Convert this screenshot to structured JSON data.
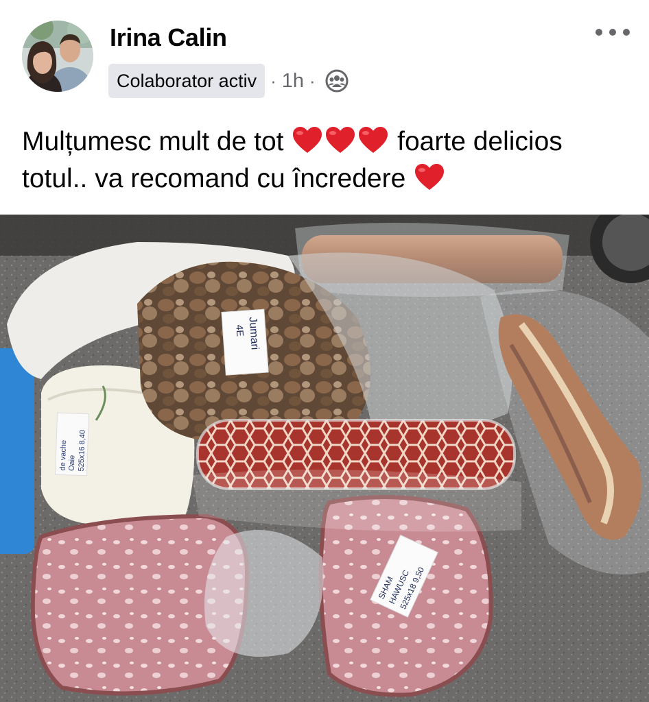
{
  "post": {
    "author": "Irina Calin",
    "badge": "Colaborator activ",
    "time": "1h",
    "separator": "·",
    "audience_icon": "group-audience-icon",
    "more_icon": "more-options-icon",
    "text_part1": "Mulțumesc mult de tot",
    "text_part2": "foarte delicios",
    "text_part3": "totul.. va recomand cu încredere",
    "heart_color": "#e0202b"
  },
  "photo_labels": {
    "label_1": "Jumari",
    "label_1_sub": "4E",
    "label_2_line1": "de vache",
    "label_2_line2": "Oaie",
    "label_2_line3": "525x16 8,40",
    "label_3_line1": "SHAM",
    "label_3_line2": "HAWUSC",
    "label_3_line3": "525x18 9,50"
  }
}
